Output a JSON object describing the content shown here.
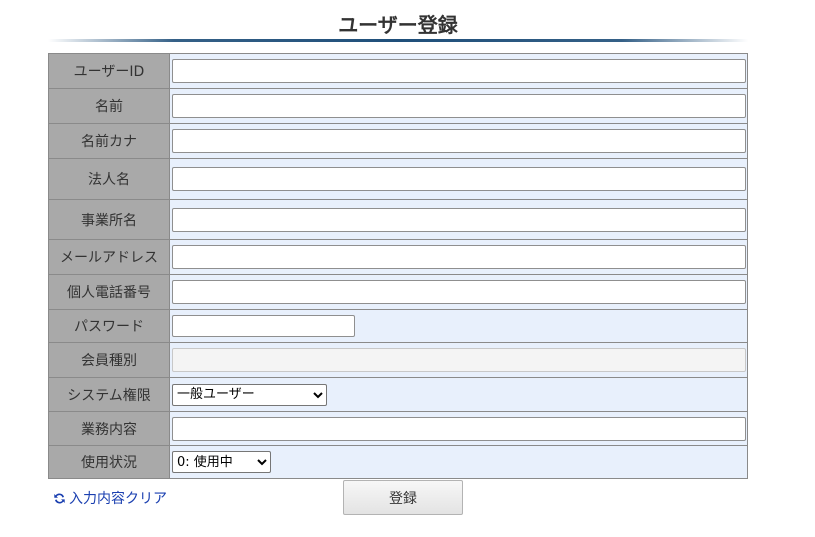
{
  "page": {
    "title": "ユーザー登録"
  },
  "form": {
    "fields": {
      "user_id": {
        "label": "ユーザーID",
        "value": ""
      },
      "name": {
        "label": "名前",
        "value": ""
      },
      "name_kana": {
        "label": "名前カナ",
        "value": ""
      },
      "corporation": {
        "label": "法人名",
        "value": ""
      },
      "office": {
        "label": "事業所名",
        "value": ""
      },
      "email": {
        "label": "メールアドレス",
        "value": ""
      },
      "phone": {
        "label": "個人電話番号",
        "value": ""
      },
      "password": {
        "label": "パスワード",
        "value": ""
      },
      "member_type": {
        "label": "会員種別",
        "value": ""
      },
      "system_role": {
        "label": "システム権限",
        "selected": "一般ユーザー",
        "options": [
          "一般ユーザー"
        ]
      },
      "business": {
        "label": "業務内容",
        "value": ""
      },
      "status": {
        "label": "使用状況",
        "selected": "0: 使用中",
        "options": [
          "0: 使用中"
        ]
      }
    }
  },
  "actions": {
    "clear_label": "入力内容クリア",
    "clear_icon": "refresh-icon",
    "submit_label": "登録"
  },
  "colors": {
    "label_bg": "#a9a9a9",
    "cell_bg": "#e8f0fc",
    "title_rule": "#1f4f7a",
    "link": "#1a3fb0"
  }
}
